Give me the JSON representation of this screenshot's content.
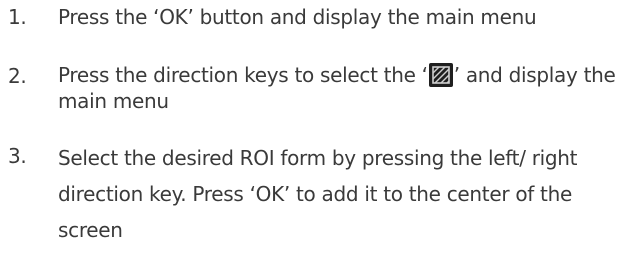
{
  "steps": [
    {
      "number": "1.",
      "text": "Press the ‘OK’ button and display the main menu"
    },
    {
      "number": "2.",
      "text_before_icon": "Press the direction keys to select the ‘",
      "icon": "roi-hatched-square-icon",
      "text_after_icon": "’ and display the main menu"
    },
    {
      "number": "3.",
      "text": "Select the desired ROI form by pressing the left/ right direction key. Press ‘OK’ to add it to the center of the screen"
    }
  ],
  "colors": {
    "text": "#3a3a3a",
    "icon_background": "#1f1f1f",
    "icon_hatch": "#cfcfcf"
  }
}
